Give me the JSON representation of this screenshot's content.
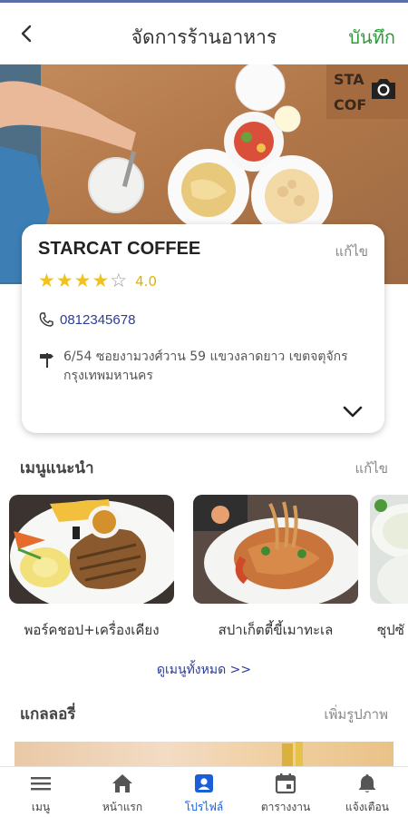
{
  "header": {
    "title": "จัดการร้านอาหาร",
    "save_label": "บันทึก"
  },
  "cover": {
    "sign_line1": "STA",
    "sign_line2": "COF"
  },
  "shop": {
    "name": "STARCAT COFFEE",
    "edit_label": "แก้ไข",
    "rating": 4.0,
    "rating_text": "4.0",
    "stars_filled": 4,
    "stars_total": 5,
    "phone": "0812345678",
    "address": "6/54 ซอยงามวงศ์วาน 59 แขวงลาดยาว เขตจตุจักร กรุงเทพมหานคร"
  },
  "menu": {
    "title": "เมนูแนะนำ",
    "edit_label": "แก้ไข",
    "items": [
      {
        "name": "พอร์คชอป+เครื่องเคียง"
      },
      {
        "name": "สปาเก็ตตี้ขี้เมาทะเล"
      },
      {
        "name": "ซุปซั"
      }
    ],
    "view_all_label": "ดูเมนูทั้งหมด >>"
  },
  "gallery": {
    "title": "แกลลอรี่",
    "add_label": "เพิ่มรูปภาพ"
  },
  "bottom_nav": {
    "items": [
      {
        "label": "เมนู",
        "icon": "hamburger-menu-icon"
      },
      {
        "label": "หน้าแรก",
        "icon": "home-icon"
      },
      {
        "label": "โปรไฟล์",
        "icon": "profile-card-icon",
        "active": true
      },
      {
        "label": "ตารางงาน",
        "icon": "calendar-icon"
      },
      {
        "label": "แจ้งเตือน",
        "icon": "bell-icon"
      }
    ]
  },
  "colors": {
    "accent_green": "#2e9b3a",
    "link_blue": "#2d3c97",
    "star_yellow": "#f2c11b",
    "nav_active": "#1b5fd8"
  }
}
